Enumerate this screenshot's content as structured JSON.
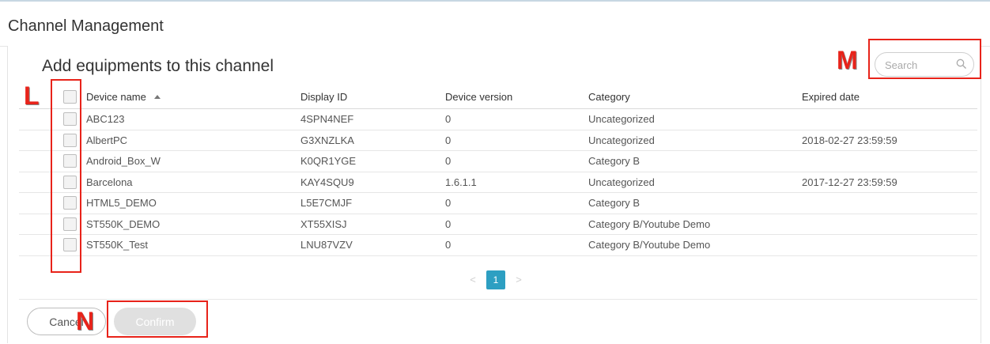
{
  "header": {
    "title": "Channel Management"
  },
  "dialog": {
    "subtitle": "Add equipments to this channel"
  },
  "search": {
    "placeholder": "Search",
    "value": ""
  },
  "table": {
    "columns": {
      "name": "Device name",
      "display_id": "Display ID",
      "version": "Device version",
      "category": "Category",
      "expired": "Expired date"
    },
    "rows": [
      {
        "name": "ABC123",
        "display_id": "4SPN4NEF",
        "version": "0",
        "category": "Uncategorized",
        "expired": ""
      },
      {
        "name": "AlbertPC",
        "display_id": "G3XNZLKA",
        "version": "0",
        "category": "Uncategorized",
        "expired": "2018-02-27 23:59:59"
      },
      {
        "name": "Android_Box_W",
        "display_id": "K0QR1YGE",
        "version": "0",
        "category": "Category B",
        "expired": ""
      },
      {
        "name": "Barcelona",
        "display_id": "KAY4SQU9",
        "version": "1.6.1.1",
        "category": "Uncategorized",
        "expired": "2017-12-27 23:59:59"
      },
      {
        "name": "HTML5_DEMO",
        "display_id": "L5E7CMJF",
        "version": "0",
        "category": "Category B",
        "expired": ""
      },
      {
        "name": "ST550K_DEMO",
        "display_id": "XT55XISJ",
        "version": "0",
        "category": "Category B/Youtube Demo",
        "expired": ""
      },
      {
        "name": "ST550K_Test",
        "display_id": "LNU87VZV",
        "version": "0",
        "category": "Category B/Youtube Demo",
        "expired": ""
      }
    ]
  },
  "pagination": {
    "prev": "<",
    "current": "1",
    "next": ">"
  },
  "footer": {
    "cancel_label": "Cancel",
    "confirm_label": "Confirm"
  },
  "annotations": {
    "checkbox_column": "L",
    "search": "M",
    "confirm": "N"
  },
  "colors": {
    "accent": "#2d9fc2",
    "annotation": "#e8231a",
    "confirm_disabled": "#e0e0e0"
  }
}
